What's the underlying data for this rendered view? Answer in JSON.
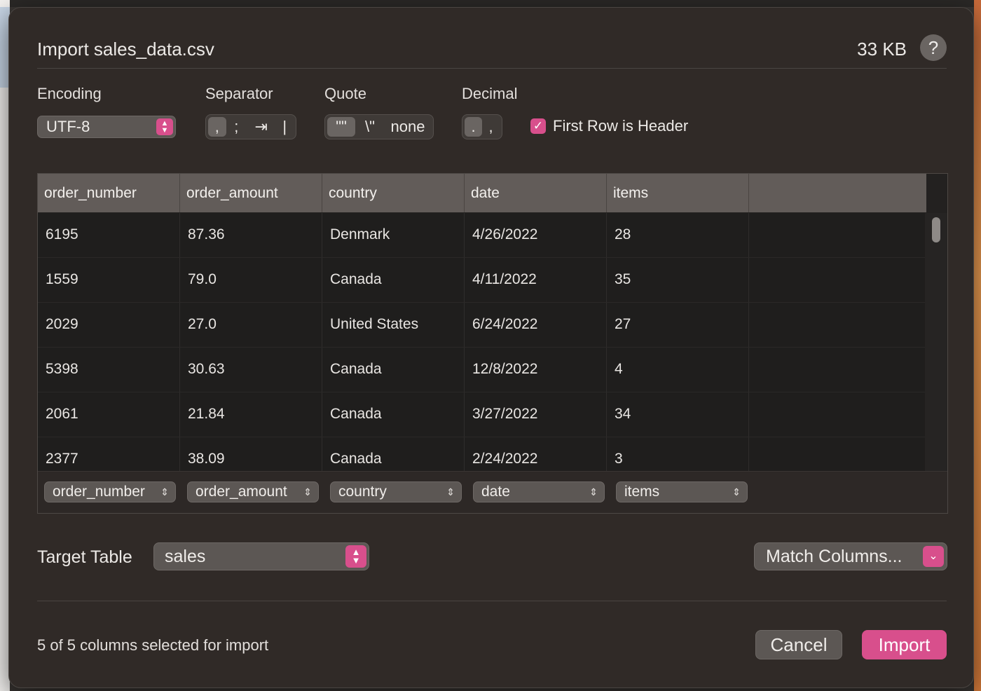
{
  "dialog": {
    "title": "Import sales_data.csv",
    "file_size": "33 KB",
    "help_label": "?"
  },
  "options": {
    "encoding": {
      "label": "Encoding",
      "value": "UTF-8"
    },
    "separator": {
      "label": "Separator",
      "options": [
        ",",
        ";",
        "⇥",
        "|"
      ],
      "selected": ","
    },
    "quote": {
      "label": "Quote",
      "options": [
        "\"\"",
        "\\\"",
        "none"
      ],
      "selected": "\"\""
    },
    "decimal": {
      "label": "Decimal",
      "options": [
        ".",
        ","
      ],
      "selected": "."
    },
    "first_row_header": {
      "label": "First Row is Header",
      "checked": true
    }
  },
  "table": {
    "columns": [
      "order_number",
      "order_amount",
      "country",
      "date",
      "items"
    ],
    "rows": [
      [
        "6195",
        "87.36",
        "Denmark",
        "4/26/2022",
        "28"
      ],
      [
        "1559",
        "79.0",
        "Canada",
        "4/11/2022",
        "35"
      ],
      [
        "2029",
        "27.0",
        "United States",
        "6/24/2022",
        "27"
      ],
      [
        "5398",
        "30.63",
        "Canada",
        "12/8/2022",
        "4"
      ],
      [
        "2061",
        "21.84",
        "Canada",
        "3/27/2022",
        "34"
      ],
      [
        "2377",
        "38.09",
        "Canada",
        "2/24/2022",
        "3"
      ]
    ],
    "mapping": [
      "order_number",
      "order_amount",
      "country",
      "date",
      "items"
    ]
  },
  "target": {
    "label": "Target Table",
    "value": "sales",
    "match_label": "Match Columns..."
  },
  "footer": {
    "status": "5 of 5 columns selected for import",
    "cancel_label": "Cancel",
    "import_label": "Import"
  },
  "colors": {
    "accent": "#d84f8c",
    "dialog_bg": "#302a27",
    "header_bg": "#625c59",
    "row_bg": "#1f1e1d"
  }
}
